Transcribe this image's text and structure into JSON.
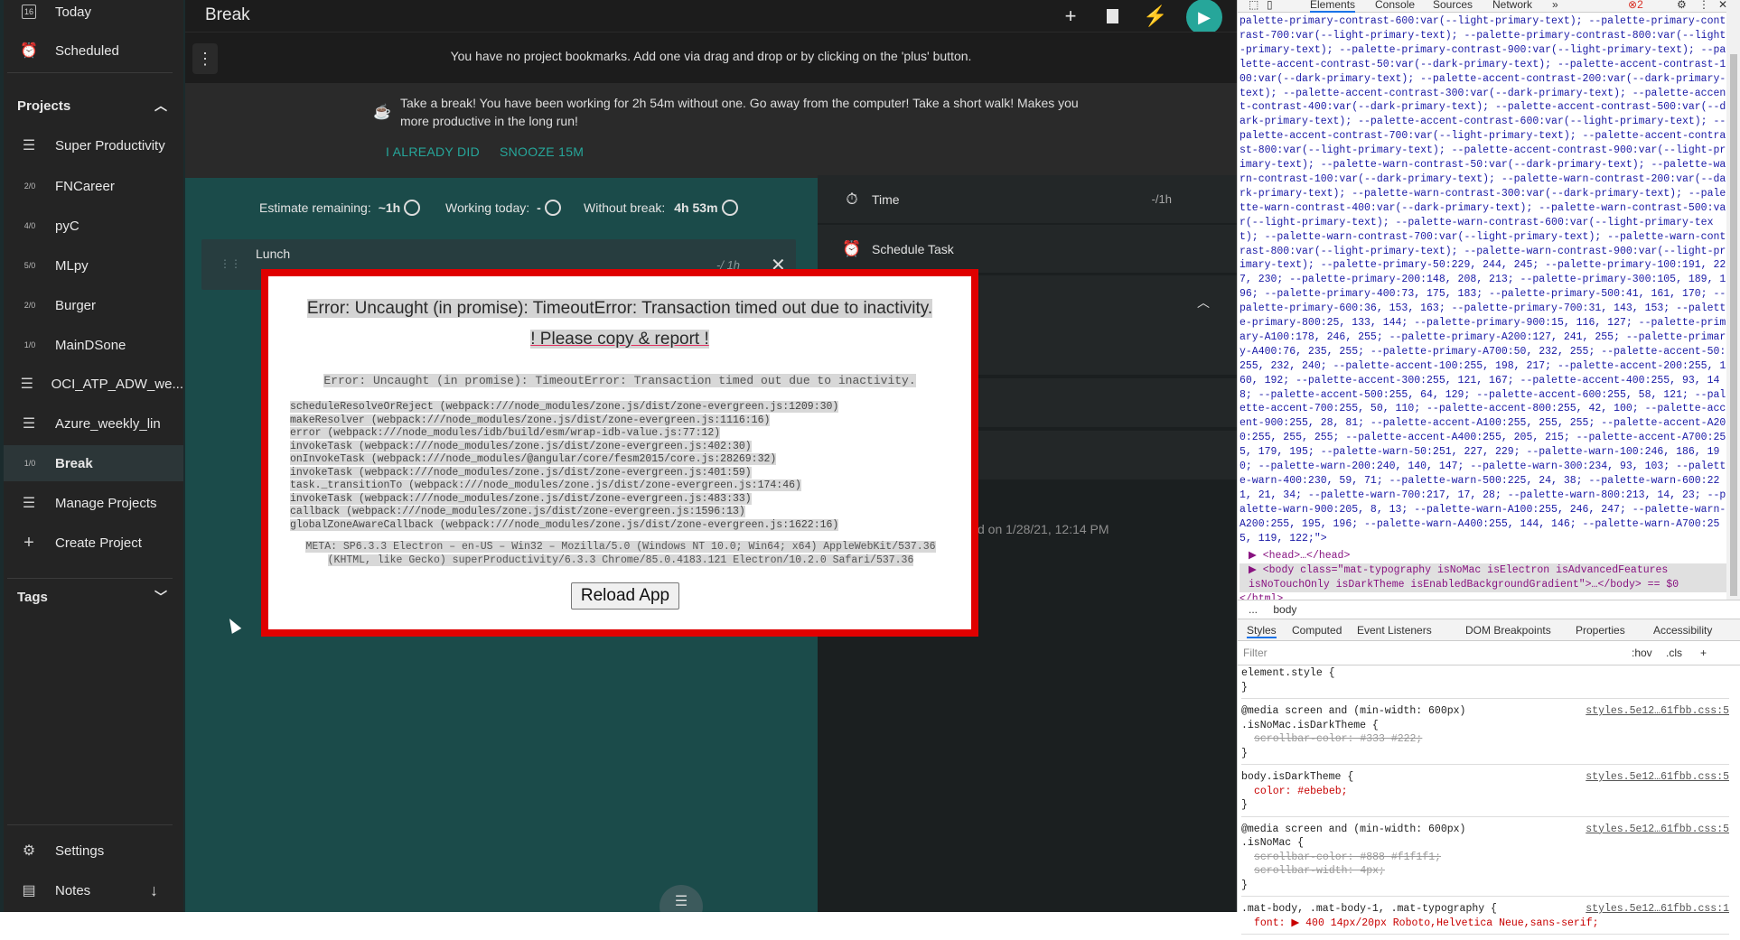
{
  "sidebar": {
    "top_items": [
      {
        "label": "Today",
        "badge": "16"
      },
      {
        "label": "Scheduled"
      }
    ],
    "projects_header": "Projects",
    "projects": [
      {
        "label": "Super Productivity",
        "badge": ""
      },
      {
        "label": "FNCareer",
        "badge": "2/0"
      },
      {
        "label": "pyC",
        "badge": "4/0"
      },
      {
        "label": "MLpy",
        "badge": "5/0"
      },
      {
        "label": "Burger",
        "badge": "2/0"
      },
      {
        "label": "MainDSone",
        "badge": "1/0"
      },
      {
        "label": "OCI_ATP_ADW_we...",
        "badge": ""
      },
      {
        "label": "Azure_weekly_lin",
        "badge": ""
      },
      {
        "label": "Break",
        "badge": "1/0"
      }
    ],
    "manage_projects": "Manage Projects",
    "create_project": "Create Project",
    "tags_header": "Tags",
    "settings": "Settings",
    "notes": "Notes"
  },
  "header": {
    "title": "Break",
    "bookmarks_message": "You have no project bookmarks. Add one via drag and drop or by clicking on the 'plus' button."
  },
  "break_banner": {
    "text": "Take a break! You have been working for 2h 54m without one. Go away from the computer! Take a short walk! Makes you more productive in the long run!",
    "already_did": "I ALREADY DID",
    "snooze": "SNOOZE 15M"
  },
  "stats": {
    "estimate_label": "Estimate remaining:",
    "estimate_value": "~1h",
    "working_label": "Working today:",
    "working_value": "-",
    "without_break_label": "Without break:",
    "without_break_value": "4h 53m"
  },
  "task": {
    "title": "Lunch",
    "estimate": "-/ 1h"
  },
  "detail": {
    "time_label": "Time",
    "time_value": "-/1h",
    "schedule_label": "Schedule Task",
    "created_text": "d on 1/28/21, 12:14 PM"
  },
  "error": {
    "title": "Error: Uncaught (in promise): TimeoutError: Transaction timed out due to inactivity.",
    "report": "! Please copy & report !",
    "mono_title": "Error: Uncaught (in promise): TimeoutError: Transaction timed out due to inactivity.",
    "stack": [
      "scheduleResolveOrReject (webpack:///node_modules/zone.js/dist/zone-evergreen.js:1209:30)",
      "makeResolver (webpack:///node_modules/zone.js/dist/zone-evergreen.js:1116:16)",
      "error (webpack:///node_modules/idb/build/esm/wrap-idb-value.js:77:12)",
      "invokeTask (webpack:///node_modules/zone.js/dist/zone-evergreen.js:402:30)",
      "onInvokeTask (webpack:///node_modules/@angular/core/fesm2015/core.js:28269:32)",
      "invokeTask (webpack:///node_modules/zone.js/dist/zone-evergreen.js:401:59)",
      "task._transitionTo (webpack:///node_modules/zone.js/dist/zone-evergreen.js:174:46)",
      "invokeTask (webpack:///node_modules/zone.js/dist/zone-evergreen.js:483:33)",
      "callback (webpack:///node_modules/zone.js/dist/zone-evergreen.js:1596:13)",
      "globalZoneAwareCallback (webpack:///node_modules/zone.js/dist/zone-evergreen.js:1622:16)"
    ],
    "meta": "META: SP6.3.3 Electron – en-US – Win32 – Mozilla/5.0 (Windows NT 10.0; Win64; x64) AppleWebKit/537.36 (KHTML, like Gecko) superProductivity/6.3.3 Chrome/85.0.4183.121 Electron/10.2.0 Safari/537.36",
    "reload_button": "Reload App"
  },
  "devtools": {
    "tabs": [
      "Elements",
      "Console",
      "Sources",
      "Network",
      "»"
    ],
    "error_count": "2",
    "css_text": "palette-primary-contrast-600:var(--light-primary-text); --palette-primary-contrast-700:var(--light-primary-text); --palette-primary-contrast-800:var(--light-primary-text); --palette-primary-contrast-900:var(--light-primary-text); --palette-accent-contrast-50:var(--dark-primary-text); --palette-accent-contrast-100:var(--dark-primary-text); --palette-accent-contrast-200:var(--dark-primary-text); --palette-accent-contrast-300:var(--dark-primary-text); --palette-accent-contrast-400:var(--dark-primary-text); --palette-accent-contrast-500:var(--dark-primary-text); --palette-accent-contrast-600:var(--light-primary-text); --palette-accent-contrast-700:var(--light-primary-text); --palette-accent-contrast-800:var(--light-primary-text); --palette-accent-contrast-900:var(--light-primary-text); --palette-warn-contrast-50:var(--dark-primary-text); --palette-warn-contrast-100:var(--dark-primary-text); --palette-warn-contrast-200:var(--dark-primary-text); --palette-warn-contrast-300:var(--dark-primary-text); --palette-warn-contrast-400:var(--dark-primary-text); --palette-warn-contrast-500:var(--light-primary-text); --palette-warn-contrast-600:var(--light-primary-text); --palette-warn-contrast-700:var(--light-primary-text); --palette-warn-contrast-800:var(--light-primary-text); --palette-warn-contrast-900:var(--light-primary-text); --palette-primary-50:229, 244, 245; --palette-primary-100:191, 227, 230; --palette-primary-200:148, 208, 213; --palette-primary-300:105, 189, 196; --palette-primary-400:73, 175, 183; --palette-primary-500:41, 161, 170; --palette-primary-600:36, 153, 163; --palette-primary-700:31, 143, 153; --palette-primary-800:25, 133, 144; --palette-primary-900:15, 116, 127; --palette-primary-A100:178, 246, 255; --palette-primary-A200:127, 241, 255; --palette-primary-A400:76, 235, 255; --palette-primary-A700:50, 232, 255; --palette-accent-50:255, 232, 240; --palette-accent-100:255, 198, 217; --palette-accent-200:255, 160, 192; --palette-accent-300:255, 121, 167; --palette-accent-400:255, 93, 148; --palette-accent-500:255, 64, 129; --palette-accent-600:255, 58, 121; --palette-accent-700:255, 50, 110; --palette-accent-800:255, 42, 100; --palette-accent-900:255, 28, 81; --palette-accent-A100:255, 255, 255; --palette-accent-A200:255, 255, 255; --palette-accent-A400:255, 205, 215; --palette-accent-A700:255, 179, 195; --palette-warn-50:251, 227, 229; --palette-warn-100:246, 186, 190; --palette-warn-200:240, 140, 147; --palette-warn-300:234, 93, 103; --palette-warn-400:230, 59, 71; --palette-warn-500:225, 24, 38; --palette-warn-600:221, 21, 34; --palette-warn-700:217, 17, 28; --palette-warn-800:213, 14, 23; --palette-warn-900:205, 8, 13; --palette-warn-A100:255, 246, 247; --palette-warn-A200:255, 195, 196; --palette-warn-A400:255, 144, 146; --palette-warn-A700:255, 119, 122;\">",
    "head_line": "▶ <head>…</head>",
    "body_line": "▶ <body class=\"mat-typography isNoMac isElectron isAdvancedFeatures isNoTouchOnly isDarkTheme isEnabledBackgroundGradient\">…</body> == $0",
    "html_close": "</html>",
    "breadcrumb": "body",
    "breadcrumb_dots": "...",
    "styles_tabs": [
      "Styles",
      "Computed",
      "Event Listeners",
      "DOM Breakpoints",
      "Properties",
      "Accessibility"
    ],
    "filter_placeholder": "Filter",
    "hov": ":hov",
    "cls": ".cls",
    "rules": [
      {
        "selector": "element.style {",
        "source": "",
        "lines": [
          "}"
        ]
      },
      {
        "selector": "@media screen and (min-width: 600px)\n.isNoMac.isDarkTheme {",
        "source": "styles.5e12…61fbb.css:5",
        "lines": [
          "scrollbar-color: #333 #222;",
          "}"
        ]
      },
      {
        "selector": "body.isDarkTheme {",
        "source": "styles.5e12…61fbb.css:5",
        "lines": [
          "color: #ebebeb;",
          "}"
        ]
      },
      {
        "selector": "@media screen and (min-width: 600px)\n.isNoMac {",
        "source": "styles.5e12…61fbb.css:5",
        "lines": [
          "scrollbar-color: #888 #f1f1f1;",
          "scrollbar-width: 4px;",
          "}"
        ]
      },
      {
        "selector": ".mat-body, .mat-body-1, .mat-typography {",
        "source": "styles.5e12…61fbb.css:1",
        "lines": [
          "font: ▶ 400 14px/20px Roboto,Helvetica Neue,sans-serif;"
        ]
      }
    ]
  }
}
